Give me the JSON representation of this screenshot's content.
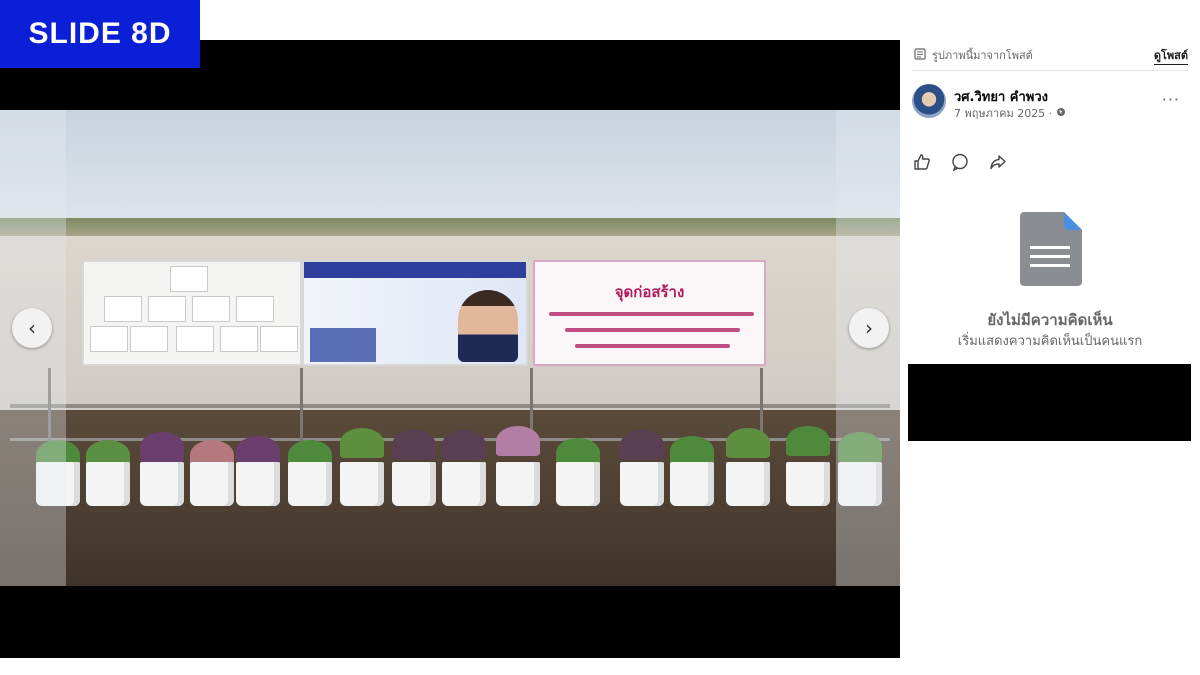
{
  "slide_tag": "SLIDE 8D",
  "viewer": {
    "prev_icon": "chevron-left-icon",
    "next_icon": "chevron-right-icon",
    "prev_glyph": "‹",
    "next_glyph": "›",
    "sign_right": {
      "title": "จุดก่อสร้าง"
    }
  },
  "panel": {
    "source_label": "รูปภาพนี้มาจากโพสต์",
    "view_post": "ดูโพสต์",
    "author": "วศ.วิทยา คำพวง",
    "date": "7 พฤษภาคม 2025 · ",
    "more": "···",
    "empty_title": "ยังไม่มีความคิดเห็น",
    "empty_subtitle": "เริ่มแสดงความคิดเห็นเป็นคนแรก"
  },
  "colors": {
    "tag_bg": "#0a1fd6",
    "sign_accent": "#b21b5c",
    "muted_text": "#65676b",
    "doc_blue": "#4a90e2"
  }
}
